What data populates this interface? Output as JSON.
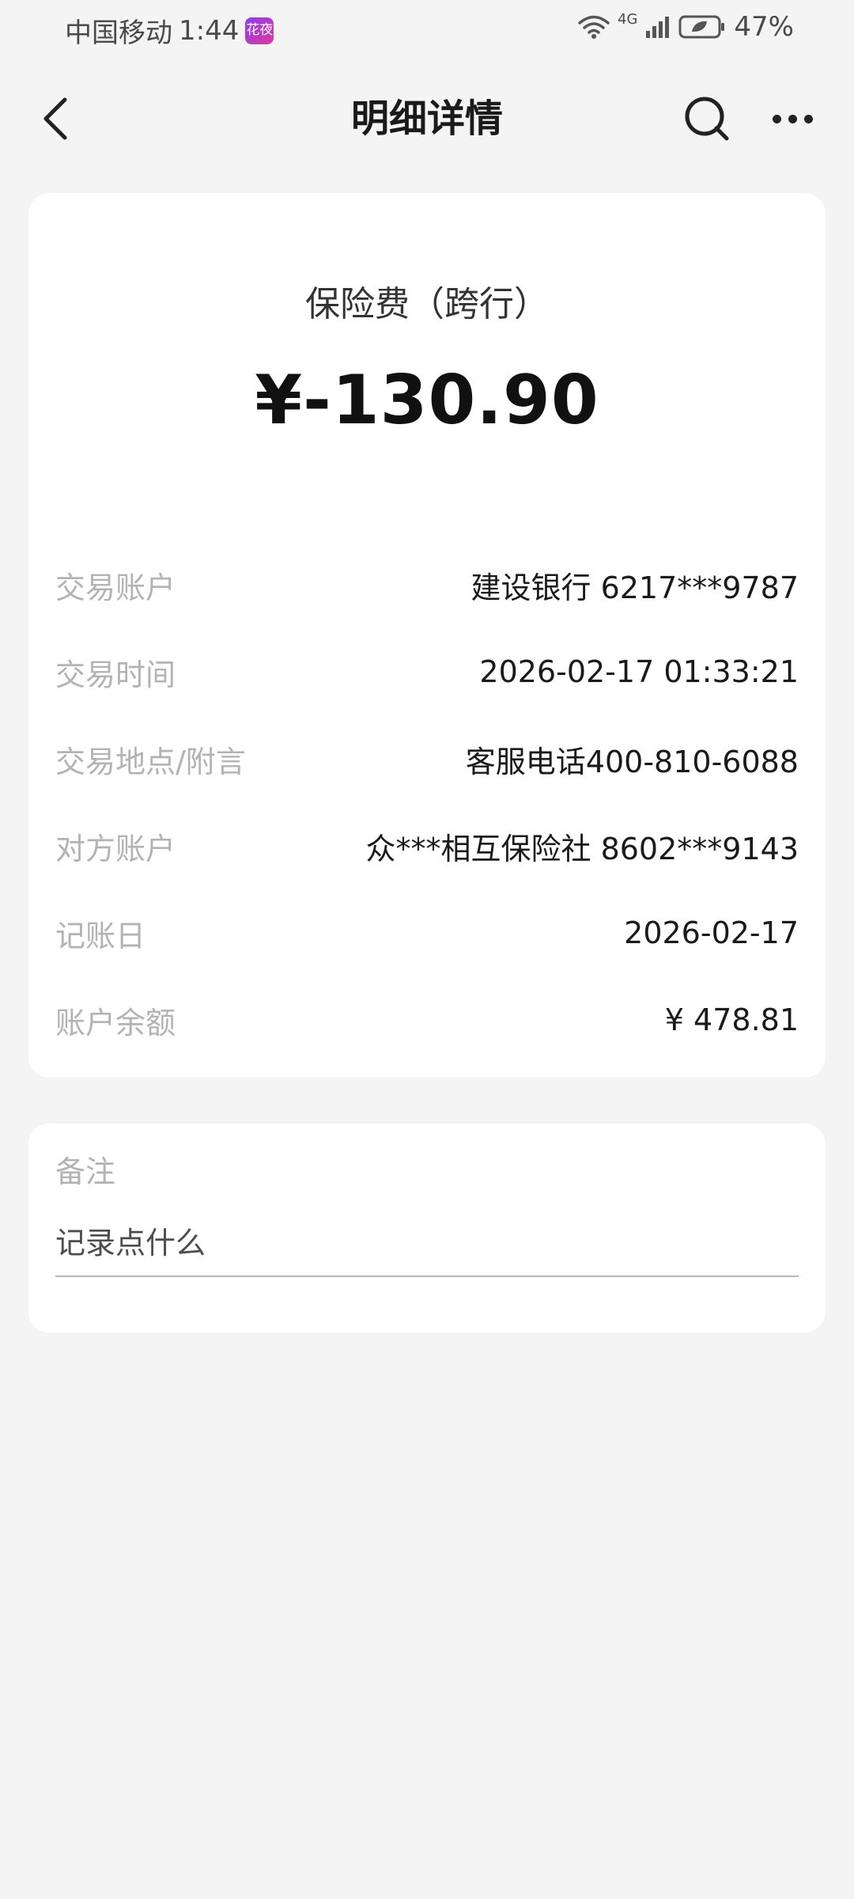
{
  "status_bar": {
    "carrier": "中国移动",
    "time": "1:44",
    "app_badge": "花夜",
    "network": "4G",
    "battery": "47%"
  },
  "header": {
    "title": "明细详情"
  },
  "transaction": {
    "type": "保险费（跨行）",
    "amount": "¥-130.90",
    "details": [
      {
        "label": "交易账户",
        "value": "建设银行 6217***9787"
      },
      {
        "label": "交易时间",
        "value": "2026-02-17 01:33:21"
      },
      {
        "label": "交易地点/附言",
        "value": "客服电话400-810-6088"
      },
      {
        "label": "对方账户",
        "value": "众***相互保险社 8602***9143"
      },
      {
        "label": "记账日",
        "value": "2026-02-17"
      },
      {
        "label": "账户余额",
        "value": "¥ 478.81"
      }
    ]
  },
  "remark": {
    "label": "备注",
    "placeholder": "记录点什么"
  },
  "icons": {
    "back": "chevron-left-icon",
    "search": "search-icon",
    "more": "more-dots-icon",
    "wifi": "wifi-icon",
    "signal": "signal-icon",
    "battery": "battery-icon"
  },
  "colors": {
    "background": "#f4f4f4",
    "card": "#ffffff",
    "label": "#b3b3b3",
    "text": "#1a1a1a"
  }
}
